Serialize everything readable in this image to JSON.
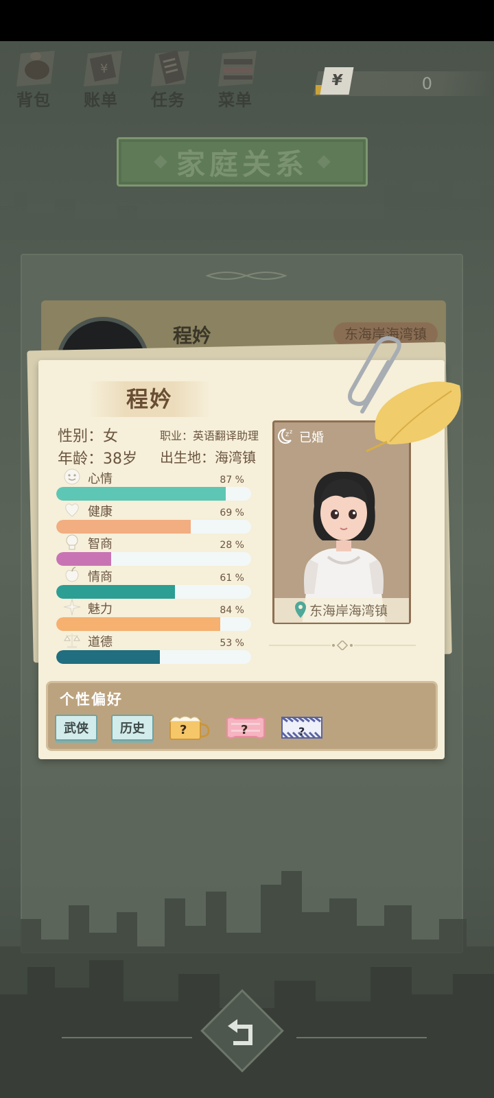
{
  "nav": {
    "items": [
      {
        "label": "背包",
        "icon": "bag-icon"
      },
      {
        "label": "账单",
        "icon": "bill-icon"
      },
      {
        "label": "任务",
        "icon": "task-icon"
      },
      {
        "label": "菜单",
        "icon": "menu-icon"
      }
    ],
    "money_symbol": "¥",
    "money_value": "0"
  },
  "title": "家庭关系",
  "background_card": {
    "name": "程妗",
    "location": "东海岸海湾镇"
  },
  "profile": {
    "name": "程妗",
    "gender": "性别：女",
    "job": "职业：英语翻译助理",
    "age": "年龄：38岁",
    "birthplace": "出生地：海湾镇",
    "status": "已婚",
    "location": "东海岸海湾镇"
  },
  "stats": [
    {
      "label": "心情",
      "percent": 87,
      "percent_text": "87 %",
      "icon": "smiley-icon",
      "color": "#5ec6b4"
    },
    {
      "label": "健康",
      "percent": 69,
      "percent_text": "69 %",
      "icon": "heart-icon",
      "color": "#f2ad80"
    },
    {
      "label": "智商",
      "percent": 28,
      "percent_text": "28 %",
      "icon": "lightbulb-icon",
      "color": "#c874b4"
    },
    {
      "label": "情商",
      "percent": 61,
      "percent_text": "61 %",
      "icon": "apple-icon",
      "color": "#2c9e94"
    },
    {
      "label": "魅力",
      "percent": 84,
      "percent_text": "84 %",
      "icon": "sparkle-icon",
      "color": "#f6b070"
    },
    {
      "label": "道德",
      "percent": 53,
      "percent_text": "53 %",
      "icon": "scale-icon",
      "color": "#206e80"
    }
  ],
  "preferences": {
    "title": "个性偏好",
    "tags": [
      {
        "label": "武侠"
      },
      {
        "label": "历史"
      },
      {
        "label": "?"
      },
      {
        "label": "?"
      },
      {
        "label": "?"
      }
    ]
  }
}
